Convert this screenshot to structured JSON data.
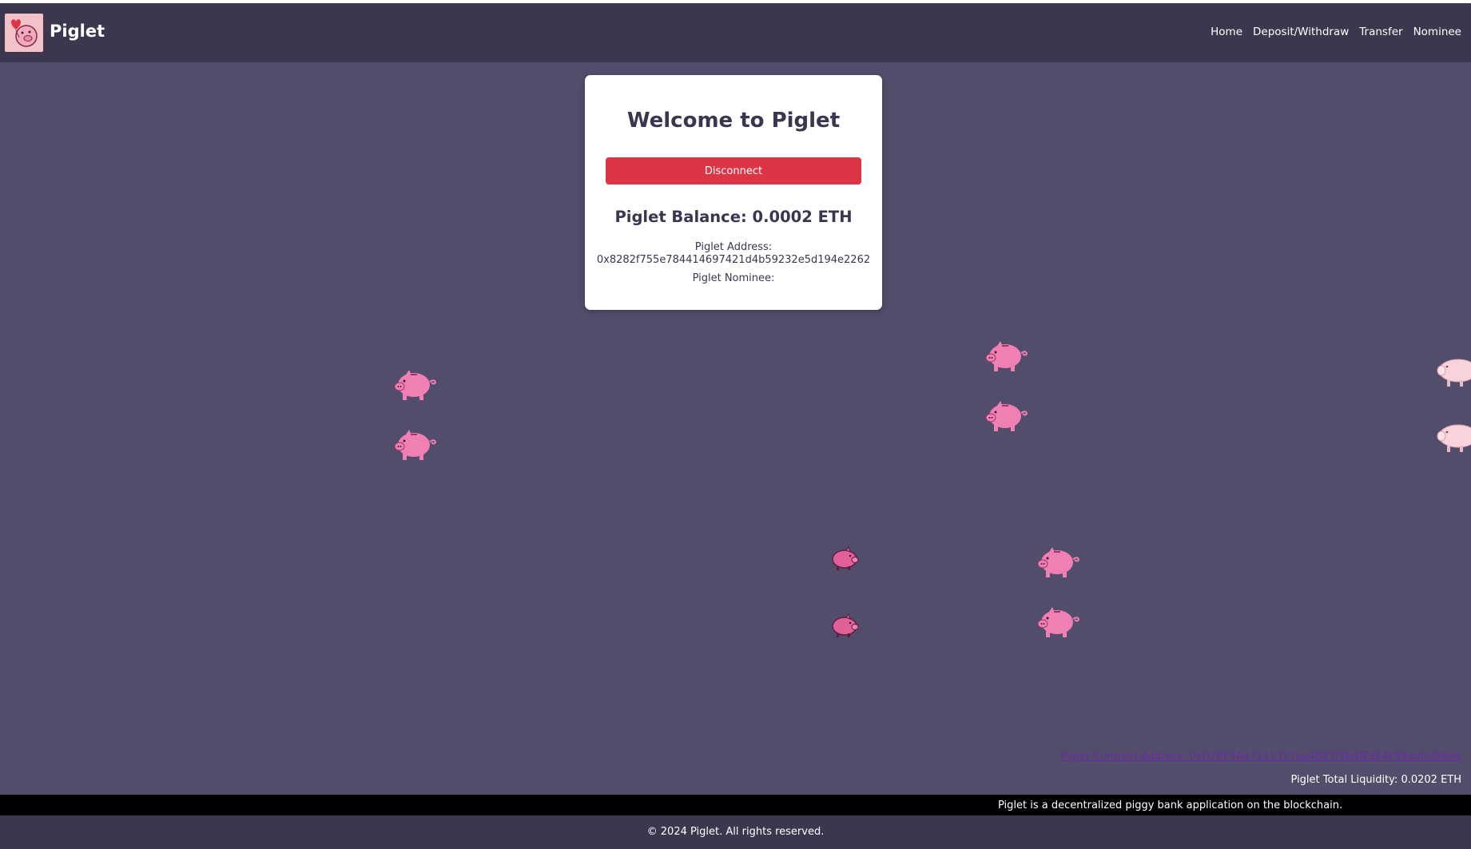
{
  "header": {
    "brand": "Piglet",
    "nav": [
      "Home",
      "Deposit/Withdraw",
      "Transfer",
      "Nominee"
    ]
  },
  "card": {
    "title": "Welcome to Piglet",
    "disconnect_label": "Disconnect",
    "balance": "Piglet Balance: 0.0002 ETH",
    "address_label": "Piglet Address:",
    "address_value": "0x8282f755e784414697421d4b59232e5d194e2262",
    "nominee_label": "Piglet Nominee:"
  },
  "info": {
    "contract": "Piglet Contract Address: 0xD76F5A47212327aa4887f3B4fE3F4F98adDd96e6",
    "liquidity": "Piglet Total Liquidity: 0.0202 ETH"
  },
  "tagline": "Piglet is a decentralized piggy bank application on the blockchain.",
  "footer": "© 2024 Piglet. All rights reserved.",
  "colors": {
    "background": "#524d6b",
    "navbar": "#3c374f",
    "disconnect": "#dc3545",
    "pig": "#f07fb4",
    "pig_light": "#f9d3dc"
  }
}
